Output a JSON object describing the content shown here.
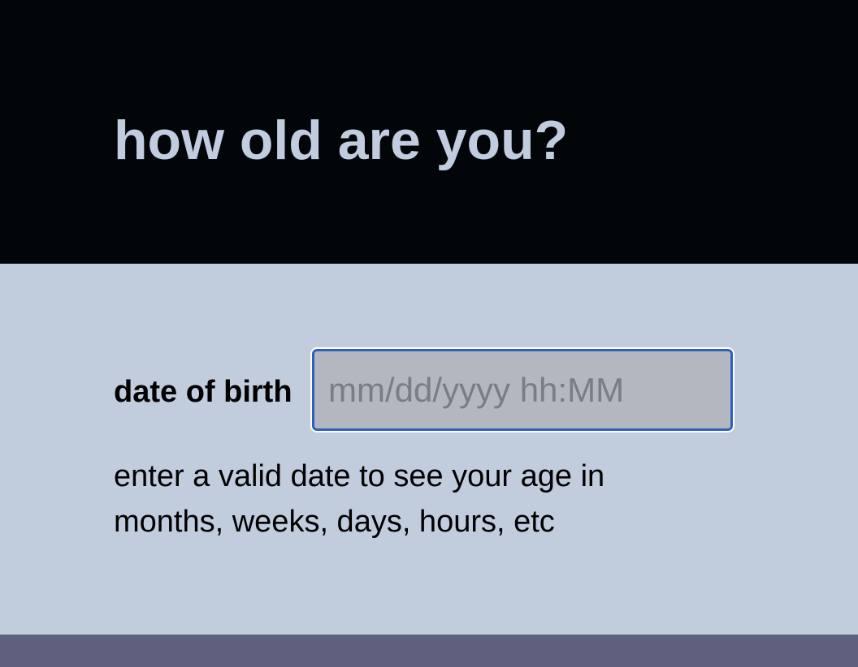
{
  "header": {
    "title": "how old are you?"
  },
  "form": {
    "dob_label": "date of birth",
    "dob_value": "",
    "dob_placeholder": "mm/dd/yyyy hh:MM",
    "hint": "enter a valid date to see your age in months, weeks, days, hours, etc"
  },
  "colors": {
    "header_bg": "#030608",
    "title_text": "#c1ccdf",
    "main_bg": "#c1ccdd",
    "input_bg": "#b3b7bf",
    "input_border": "#2e5fc2",
    "footer_bg": "#5f607e"
  }
}
